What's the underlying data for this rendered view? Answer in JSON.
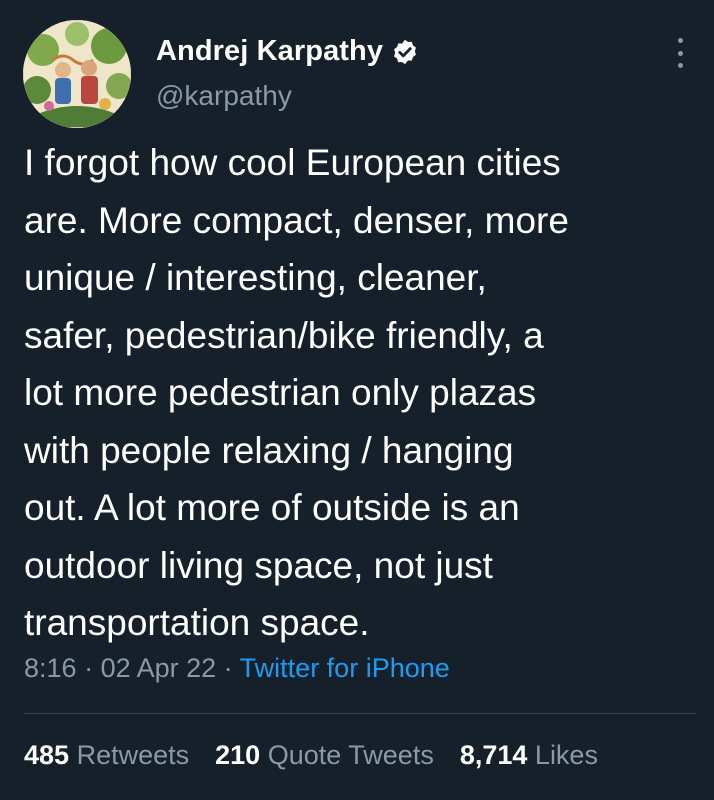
{
  "author": {
    "display_name": "Andrej Karpathy",
    "handle": "@karpathy",
    "verified": true,
    "avatar_icon": "illustrated-avatar"
  },
  "tweet": {
    "lines": [
      "I forgot how cool European cities",
      "are. More compact, denser, more",
      "unique / interesting, cleaner,",
      "safer, pedestrian/bike friendly, a",
      "lot more pedestrian only plazas",
      "with people relaxing / hanging",
      "out. A lot more of outside is an",
      "outdoor living space, not just",
      "transportation space."
    ]
  },
  "meta": {
    "time": "8:16",
    "separator": " · ",
    "date": "02 Apr 22",
    "source": "Twitter for iPhone"
  },
  "stats": {
    "retweets_count": "485",
    "retweets_label": "Retweets",
    "quotes_count": "210",
    "quotes_label": "Quote Tweets",
    "likes_count": "8,714",
    "likes_label": "Likes"
  },
  "colors": {
    "background": "#15202b",
    "text_primary": "#ffffff",
    "text_secondary": "#8b98a5",
    "link": "#1d9bf0",
    "divider": "#38444d"
  }
}
